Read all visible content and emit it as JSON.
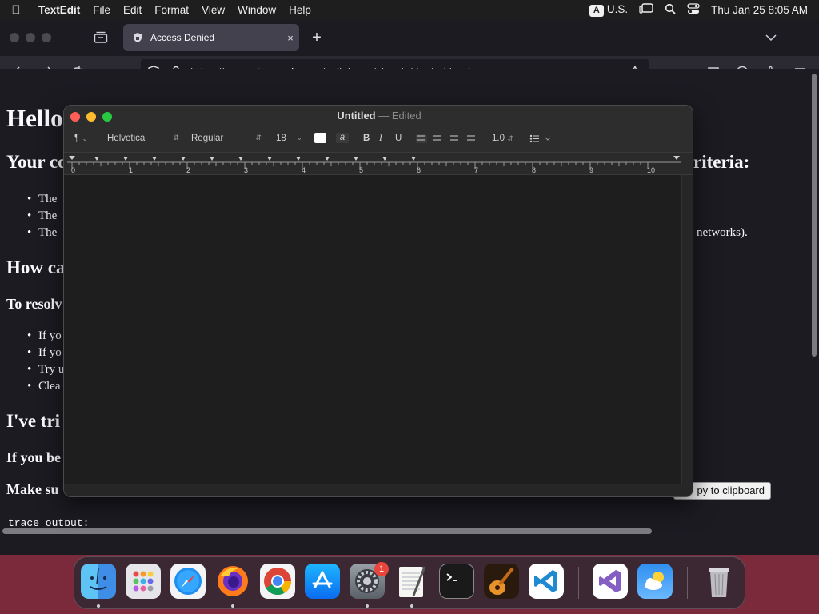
{
  "menubar": {
    "apple": "",
    "app_name": "TextEdit",
    "items": [
      "File",
      "Edit",
      "Format",
      "View",
      "Window",
      "Help"
    ],
    "input_source_letter": "A",
    "input_source": "U.S.",
    "datetime": "Thu Jan 25  8:05 AM"
  },
  "browser": {
    "tab_title": "Access Denied",
    "tab_close": "×",
    "new_tab": "+",
    "url_prefix": "https://",
    "url_domain": "computernewb.com",
    "url_path": "/collab-vm/classic/denied.html"
  },
  "page": {
    "heading1": "Hello",
    "heading2_left": "Your co",
    "heading2_right": "riteria:",
    "list1": [
      "The",
      "The",
      "The"
    ],
    "list1_tail": "networks).",
    "heading_how": "How ca",
    "resolve_left": "To resolv",
    "list2": [
      "If yo",
      "If yo",
      "Try u",
      "Clea"
    ],
    "heading_tried": "I've tri",
    "if_you_be": "If you be",
    "make_sure": "Make su",
    "copy_button": "py to clipboard",
    "trace_label": "trace output:"
  },
  "textedit": {
    "title": "Untitled",
    "separator": "—",
    "status": "Edited",
    "toolbar": {
      "paragraph_style": "¶",
      "font_family": "Helvetica",
      "font_style": "Regular",
      "font_size": "18",
      "bold": "B",
      "italic": "I",
      "underline": "U",
      "line_spacing": "1.0"
    },
    "ruler_numbers": [
      "0",
      "1",
      "2",
      "3",
      "4",
      "5",
      "6",
      "7",
      "8",
      "9",
      "10"
    ]
  },
  "dock": {
    "apps": [
      "Finder",
      "Launchpad",
      "Safari",
      "Firefox",
      "Chrome",
      "App Store",
      "System Settings",
      "TextEdit",
      "Terminal",
      "GarageBand",
      "Visual Studio Code",
      "Visual Studio",
      "Weather",
      "Trash"
    ],
    "settings_badge": "1"
  },
  "colors": {
    "close": "#ff5f57",
    "minimize": "#febc2e",
    "zoom": "#28c840",
    "firefox_bg": "#1c1b22",
    "dock_badge": "#e8453c"
  }
}
